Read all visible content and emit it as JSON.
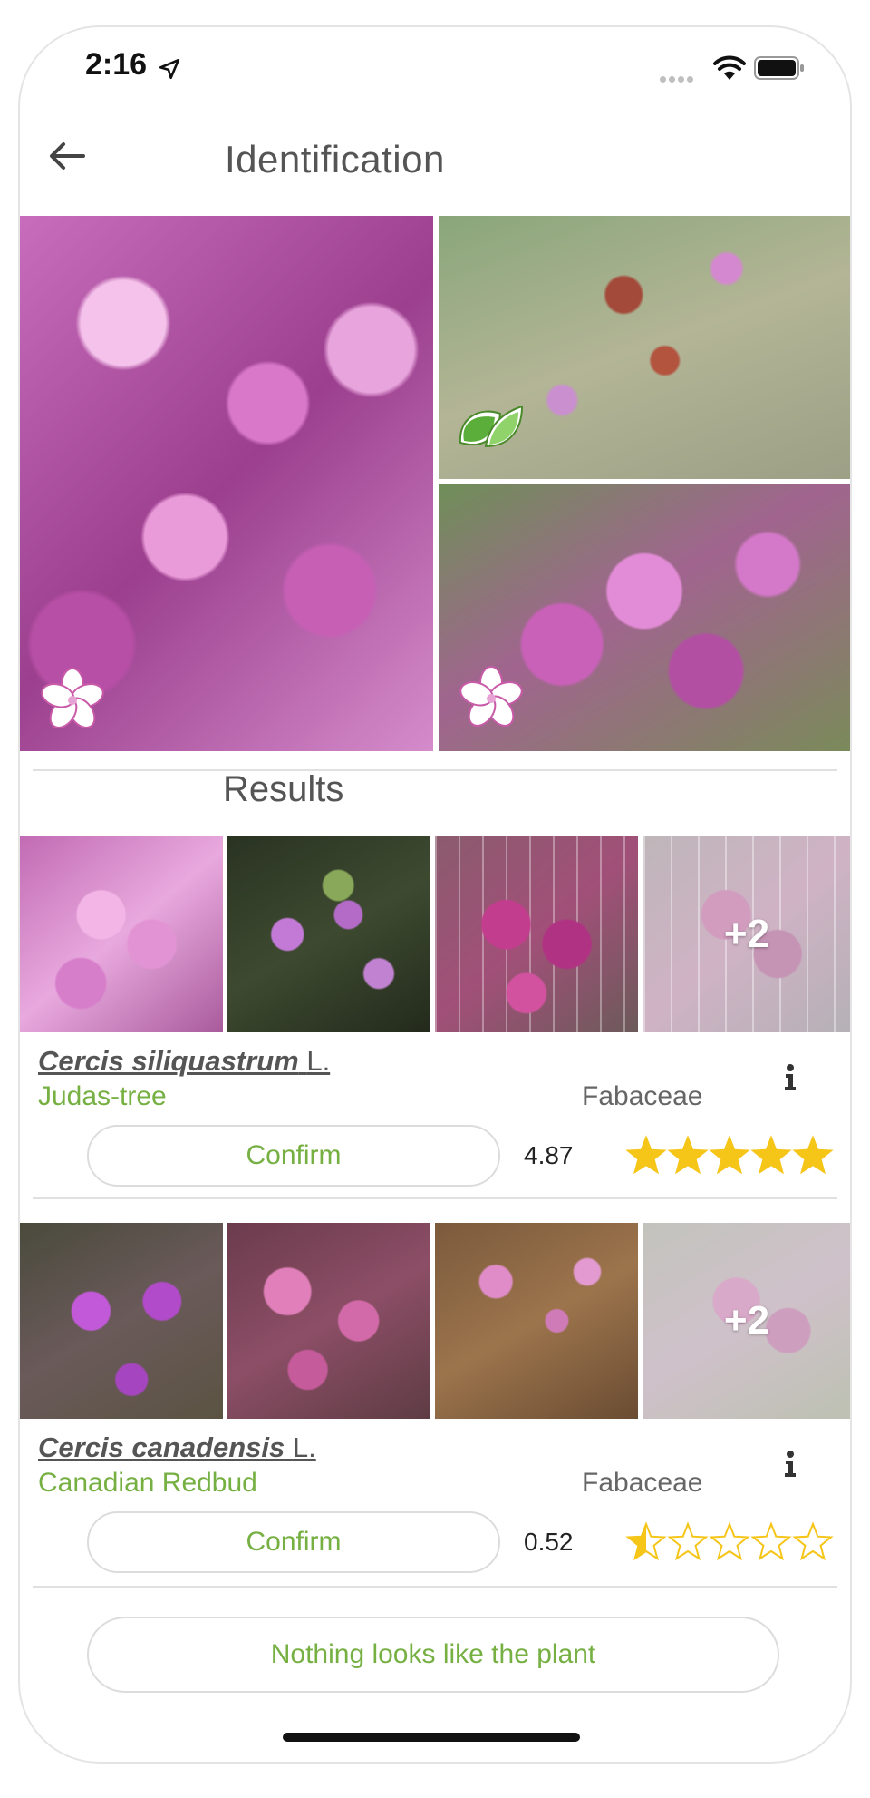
{
  "status_bar": {
    "time": "2:16",
    "icons": [
      "location-arrow-icon",
      "cellular-signal-icon",
      "wifi-icon",
      "battery-icon"
    ]
  },
  "header": {
    "back_icon": "back-arrow-icon",
    "title": "Identification"
  },
  "gallery": {
    "photos": [
      {
        "organ": "flower",
        "badge_icon": "flower-icon"
      },
      {
        "organ": "leaf",
        "badge_icon": "leaf-icon"
      },
      {
        "organ": "flower",
        "badge_icon": "flower-icon"
      }
    ]
  },
  "results": {
    "title": "Results",
    "items": [
      {
        "scientific_name": "Cercis siliquastrum",
        "author": "L.",
        "common_name": "Judas-tree",
        "family": "Fabaceae",
        "more_images": "+2",
        "confirm_label": "Confirm",
        "score": "4.87",
        "rating": 5
      },
      {
        "scientific_name": "Cercis canadensis",
        "author": "L.",
        "common_name": "Canadian Redbud",
        "family": "Fabaceae",
        "more_images": "+2",
        "confirm_label": "Confirm",
        "score": "0.52",
        "rating": 0.5
      }
    ]
  },
  "footer": {
    "nothing_label": "Nothing looks like the plant"
  },
  "colors": {
    "accent_green": "#76b043",
    "star_gold": "#f5c518",
    "divider": "#e0e0e0"
  }
}
